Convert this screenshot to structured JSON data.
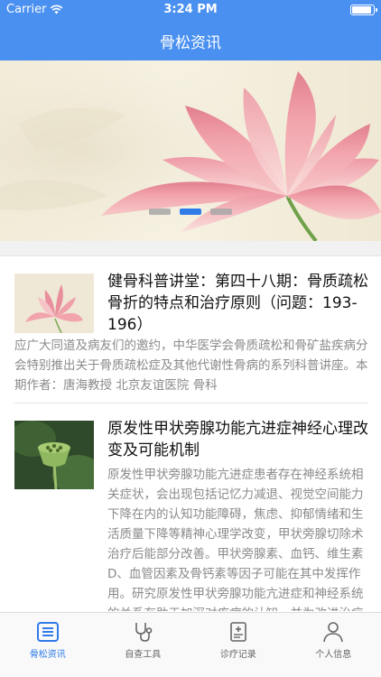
{
  "status_bar": {
    "carrier": "Carrier",
    "time": "3:24 PM",
    "battery_level": 0.95
  },
  "nav": {
    "title": "骨松资讯"
  },
  "banner": {
    "page_count": 3,
    "active_page": 2
  },
  "articles": [
    {
      "title": "健骨科普讲堂：第四十八期：骨质疏松骨折的特点和治疗原则（问题：193-196）",
      "summary": "应广大同道及病友们的邀约，中华医学会骨质疏松和骨矿盐疾病分会特别推出关于骨质疏松症及其他代谢性骨病的系列科普讲座。本期作者：唐海教授 北京友谊医院 骨科"
    },
    {
      "title": "原发性甲状旁腺功能亢进症神经心理改变及可能机制",
      "summary": "原发性甲状旁腺功能亢进症患者存在神经系统相关症状，会出现包括记忆力减退、视觉空间能力下降在内的认知功能障碍，焦虑、抑郁情绪和生活质量下降等精神心理学改变，甲状旁腺切除术治疗后能部分改善。甲状旁腺素、血钙、维生素D、血管因素及骨钙素等因子可能在其中发挥作用。研究原发性甲状旁腺功能亢进症和神经系统的关系有助于加深对疾病的认知，并为改进治疗方案"
    }
  ],
  "tabbar": {
    "tabs": [
      {
        "label": "骨松资讯",
        "icon": "news-list-icon",
        "active": true
      },
      {
        "label": "自查工具",
        "icon": "stethoscope-icon",
        "active": false
      },
      {
        "label": "诊疗记录",
        "icon": "medical-record-icon",
        "active": false
      },
      {
        "label": "个人信息",
        "icon": "person-icon",
        "active": false
      }
    ]
  },
  "colors": {
    "accent": "#4a90f0",
    "tab_active": "#2f7be8",
    "text_secondary": "#8a8a8a"
  }
}
